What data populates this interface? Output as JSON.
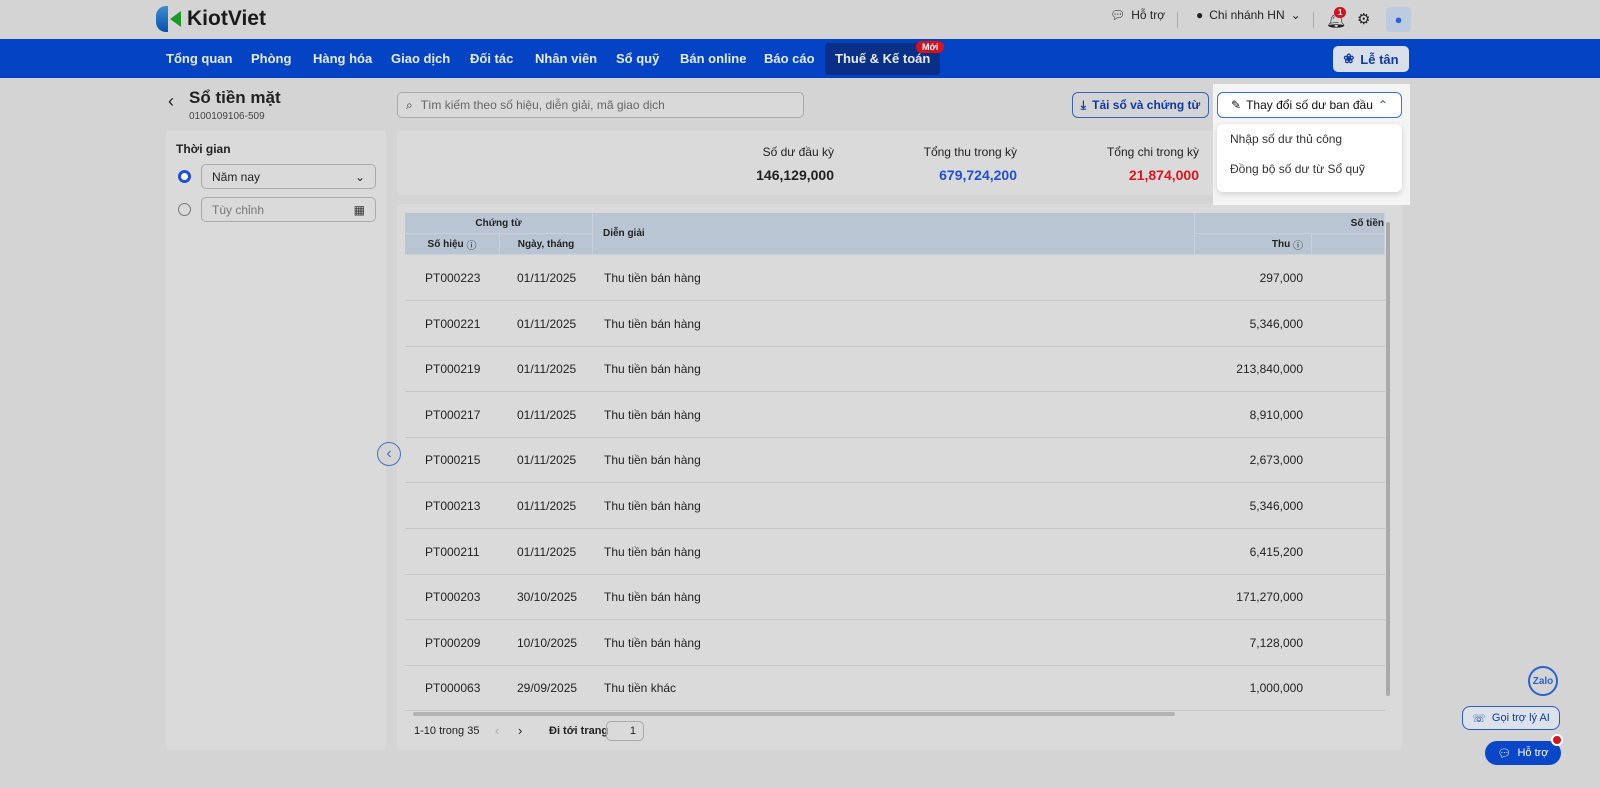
{
  "brand": "KiotViet",
  "topbar": {
    "support": "Hỗ trợ",
    "branch": "Chi nhánh HN",
    "notif_count": "1"
  },
  "nav": {
    "items": [
      "Tổng quan",
      "Phòng",
      "Hàng hóa",
      "Giao dịch",
      "Đối tác",
      "Nhân viên",
      "Sổ quỹ",
      "Bán online",
      "Báo cáo",
      "Thuế & Kế toán"
    ],
    "new_badge": "Mới",
    "reception": "Lễ tân"
  },
  "page": {
    "title": "Sổ tiền mặt",
    "subtitle": "0100109106-509"
  },
  "search": {
    "placeholder": "Tìm kiếm theo số hiệu, diễn giải, mã giao dịch"
  },
  "actions": {
    "download": "Tải sổ và chứng từ",
    "change_balance": "Thay đổi số dư ban đầu",
    "menu": [
      "Nhập số dư thủ công",
      "Đồng bộ số dư từ Sổ quỹ"
    ]
  },
  "filter": {
    "title": "Thời gian",
    "preset": "Năm nay",
    "custom": "Tùy chỉnh"
  },
  "summary": {
    "opening_label": "Số dư đầu kỳ",
    "opening": "146,129,000",
    "income_label": "Tổng thu trong kỳ",
    "income": "679,724,200",
    "expense_label": "Tổng chi trong kỳ",
    "expense": "21,874,000",
    "colors": {
      "income": "#1f4fd6",
      "expense": "#e0141c"
    }
  },
  "table": {
    "group_voucher": "Chứng từ",
    "group_amount": "Số tiền",
    "col_no": "Số hiệu",
    "col_date": "Ngày, tháng",
    "col_desc": "Diễn giải",
    "col_in": "Thu",
    "rows": [
      {
        "no": "PT000223",
        "date": "01/11/2025",
        "desc": "Thu tiền bán hàng",
        "in": "297,000"
      },
      {
        "no": "PT000221",
        "date": "01/11/2025",
        "desc": "Thu tiền bán hàng",
        "in": "5,346,000"
      },
      {
        "no": "PT000219",
        "date": "01/11/2025",
        "desc": "Thu tiền bán hàng",
        "in": "213,840,000"
      },
      {
        "no": "PT000217",
        "date": "01/11/2025",
        "desc": "Thu tiền bán hàng",
        "in": "8,910,000"
      },
      {
        "no": "PT000215",
        "date": "01/11/2025",
        "desc": "Thu tiền bán hàng",
        "in": "2,673,000"
      },
      {
        "no": "PT000213",
        "date": "01/11/2025",
        "desc": "Thu tiền bán hàng",
        "in": "5,346,000"
      },
      {
        "no": "PT000211",
        "date": "01/11/2025",
        "desc": "Thu tiền bán hàng",
        "in": "6,415,200"
      },
      {
        "no": "PT000203",
        "date": "30/10/2025",
        "desc": "Thu tiền bán hàng",
        "in": "171,270,000"
      },
      {
        "no": "PT000209",
        "date": "10/10/2025",
        "desc": "Thu tiền bán hàng",
        "in": "7,128,000"
      },
      {
        "no": "PT000063",
        "date": "29/09/2025",
        "desc": "Thu tiền khác",
        "in": "1,000,000"
      }
    ]
  },
  "pagination": {
    "range": "1-10 trong 35",
    "goto": "Đi tới trang",
    "page": "1"
  },
  "widgets": {
    "zalo": "Zalo",
    "ai": "Gọi trợ lý AI",
    "support": "Hỗ trợ"
  }
}
